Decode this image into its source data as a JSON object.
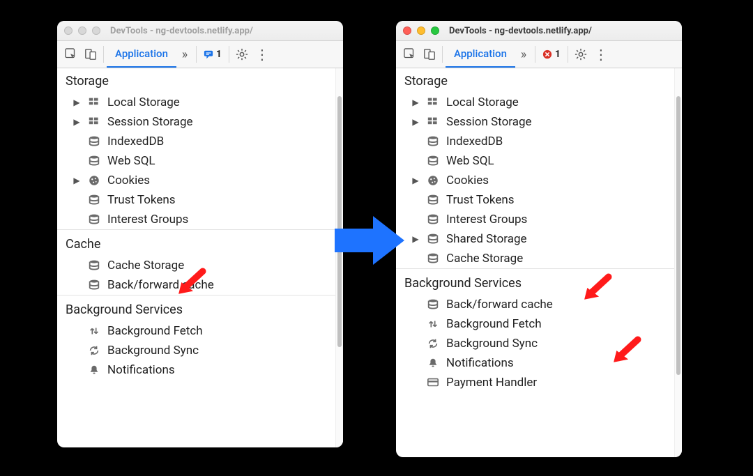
{
  "left": {
    "inactive": true,
    "title": "DevTools - ng-devtools.netlify.app/",
    "toolbar": {
      "tab_label": "Application",
      "more_tabs_glyph": "»",
      "badge_count": "1",
      "badge_kind": "message"
    },
    "sections": [
      {
        "name": "Storage",
        "items": [
          {
            "label": "Local Storage",
            "icon": "grid",
            "expandable": true
          },
          {
            "label": "Session Storage",
            "icon": "grid",
            "expandable": true
          },
          {
            "label": "IndexedDB",
            "icon": "db",
            "expandable": false
          },
          {
            "label": "Web SQL",
            "icon": "db",
            "expandable": false
          },
          {
            "label": "Cookies",
            "icon": "cookie",
            "expandable": true
          },
          {
            "label": "Trust Tokens",
            "icon": "db",
            "expandable": false
          },
          {
            "label": "Interest Groups",
            "icon": "db",
            "expandable": false
          }
        ]
      },
      {
        "name": "Cache",
        "items": [
          {
            "label": "Cache Storage",
            "icon": "db",
            "expandable": false
          },
          {
            "label": "Back/forward cache",
            "icon": "db",
            "expandable": false
          }
        ]
      },
      {
        "name": "Background Services",
        "items": [
          {
            "label": "Background Fetch",
            "icon": "updown",
            "expandable": false
          },
          {
            "label": "Background Sync",
            "icon": "sync",
            "expandable": false
          },
          {
            "label": "Notifications",
            "icon": "bell",
            "expandable": false
          }
        ]
      }
    ]
  },
  "right": {
    "inactive": false,
    "title": "DevTools - ng-devtools.netlify.app/",
    "toolbar": {
      "tab_label": "Application",
      "more_tabs_glyph": "»",
      "badge_count": "1",
      "badge_kind": "error"
    },
    "sections": [
      {
        "name": "Storage",
        "items": [
          {
            "label": "Local Storage",
            "icon": "grid",
            "expandable": true
          },
          {
            "label": "Session Storage",
            "icon": "grid",
            "expandable": true
          },
          {
            "label": "IndexedDB",
            "icon": "db",
            "expandable": false
          },
          {
            "label": "Web SQL",
            "icon": "db",
            "expandable": false
          },
          {
            "label": "Cookies",
            "icon": "cookie",
            "expandable": true
          },
          {
            "label": "Trust Tokens",
            "icon": "db",
            "expandable": false
          },
          {
            "label": "Interest Groups",
            "icon": "db",
            "expandable": false
          },
          {
            "label": "Shared Storage",
            "icon": "db",
            "expandable": true
          },
          {
            "label": "Cache Storage",
            "icon": "db",
            "expandable": false
          }
        ]
      },
      {
        "name": "Background Services",
        "items": [
          {
            "label": "Back/forward cache",
            "icon": "db",
            "expandable": false
          },
          {
            "label": "Background Fetch",
            "icon": "updown",
            "expandable": false
          },
          {
            "label": "Background Sync",
            "icon": "sync",
            "expandable": false
          },
          {
            "label": "Notifications",
            "icon": "bell",
            "expandable": false
          },
          {
            "label": "Payment Handler",
            "icon": "card",
            "expandable": false
          }
        ]
      }
    ]
  }
}
